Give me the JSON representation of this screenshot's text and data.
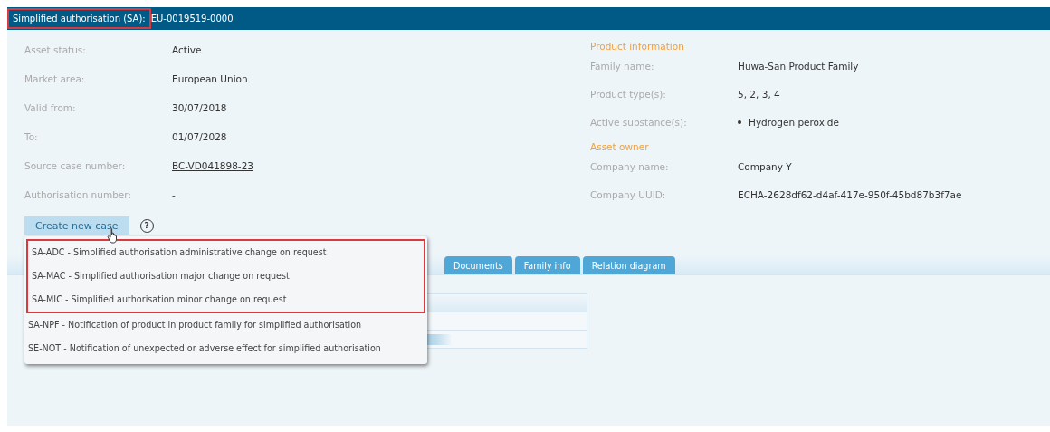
{
  "header": {
    "label": "Simplified authorisation (SA):",
    "label_highlighted": true,
    "value": "EU-0019519-0000"
  },
  "details": [
    {
      "label": "Asset status:",
      "value": "Active",
      "kind": "text"
    },
    {
      "label": "Market area:",
      "value": "European Union",
      "kind": "text"
    },
    {
      "label": "Valid from:",
      "value": "30/07/2018",
      "kind": "text"
    },
    {
      "label": "To:",
      "value": "01/07/2028",
      "kind": "text"
    },
    {
      "label": "Source case number:",
      "value": "BC-VD041898-23",
      "kind": "link"
    },
    {
      "label": "Authorisation number:",
      "value": "-",
      "kind": "text"
    }
  ],
  "sections": [
    {
      "title": "Product information",
      "fields": [
        {
          "label": "Family name:",
          "value": "Huwa-San Product Family",
          "kind": "text"
        },
        {
          "label": "Product type(s):",
          "value": "5, 2, 3, 4",
          "kind": "text"
        },
        {
          "label": "Active substance(s):",
          "value": "Hydrogen peroxide",
          "kind": "bullet"
        }
      ]
    },
    {
      "title": "Asset owner",
      "fields": [
        {
          "label": "Company name:",
          "value": "Company Y",
          "kind": "text"
        },
        {
          "label": "Company UUID:",
          "value": "ECHA-2628df62-d4af-417e-950f-45bd87b3f7ae",
          "kind": "text"
        }
      ]
    }
  ],
  "create_button": {
    "label": "Create new case"
  },
  "help_icon": "?",
  "menu": [
    {
      "label": "SA-ADC - Simplified authorisation administrative change on request",
      "highlighted": true
    },
    {
      "label": "SA-MAC - Simplified authorisation major change on request",
      "highlighted": true
    },
    {
      "label": "SA-MIC - Simplified authorisation minor change on request",
      "highlighted": true
    },
    {
      "label": "SA-NPF - Notification of product in product family for simplified authorisation",
      "highlighted": false
    },
    {
      "label": "SE-NOT - Notification of unexpected or adverse effect for simplified authorisation",
      "highlighted": false
    }
  ],
  "tabs": [
    {
      "label": "Documents",
      "selected": false
    },
    {
      "label": "Family info",
      "selected": false
    },
    {
      "label": "Relation diagram",
      "selected": false
    }
  ]
}
